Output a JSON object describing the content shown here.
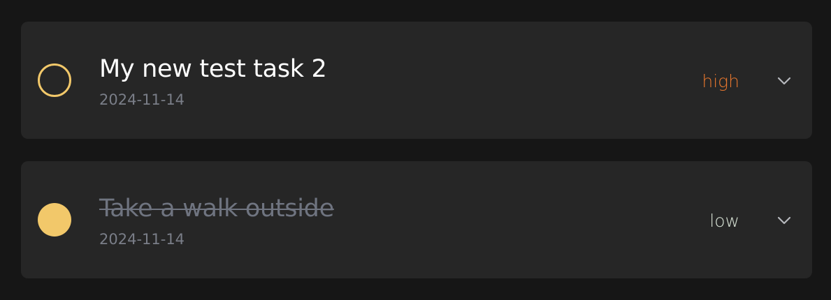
{
  "tasks": [
    {
      "title": "My new test task 2",
      "date": "2024-11-14",
      "priority": "high",
      "completed": false,
      "priority_color": "#e8772e"
    },
    {
      "title": "Take a walk outside",
      "date": "2024-11-14",
      "priority": "low",
      "completed": true,
      "priority_color": "#d8e3d6"
    }
  ],
  "icons": {
    "check_open": "checkbox-unchecked-icon",
    "check_done": "checkbox-checked-icon",
    "expand": "chevron-down-icon"
  },
  "colors": {
    "background": "#161616",
    "card": "#262626",
    "checkbox_accent": "#f2c86a",
    "title": "#ffffff",
    "title_completed": "#6f7480",
    "date": "#7a7e88"
  }
}
